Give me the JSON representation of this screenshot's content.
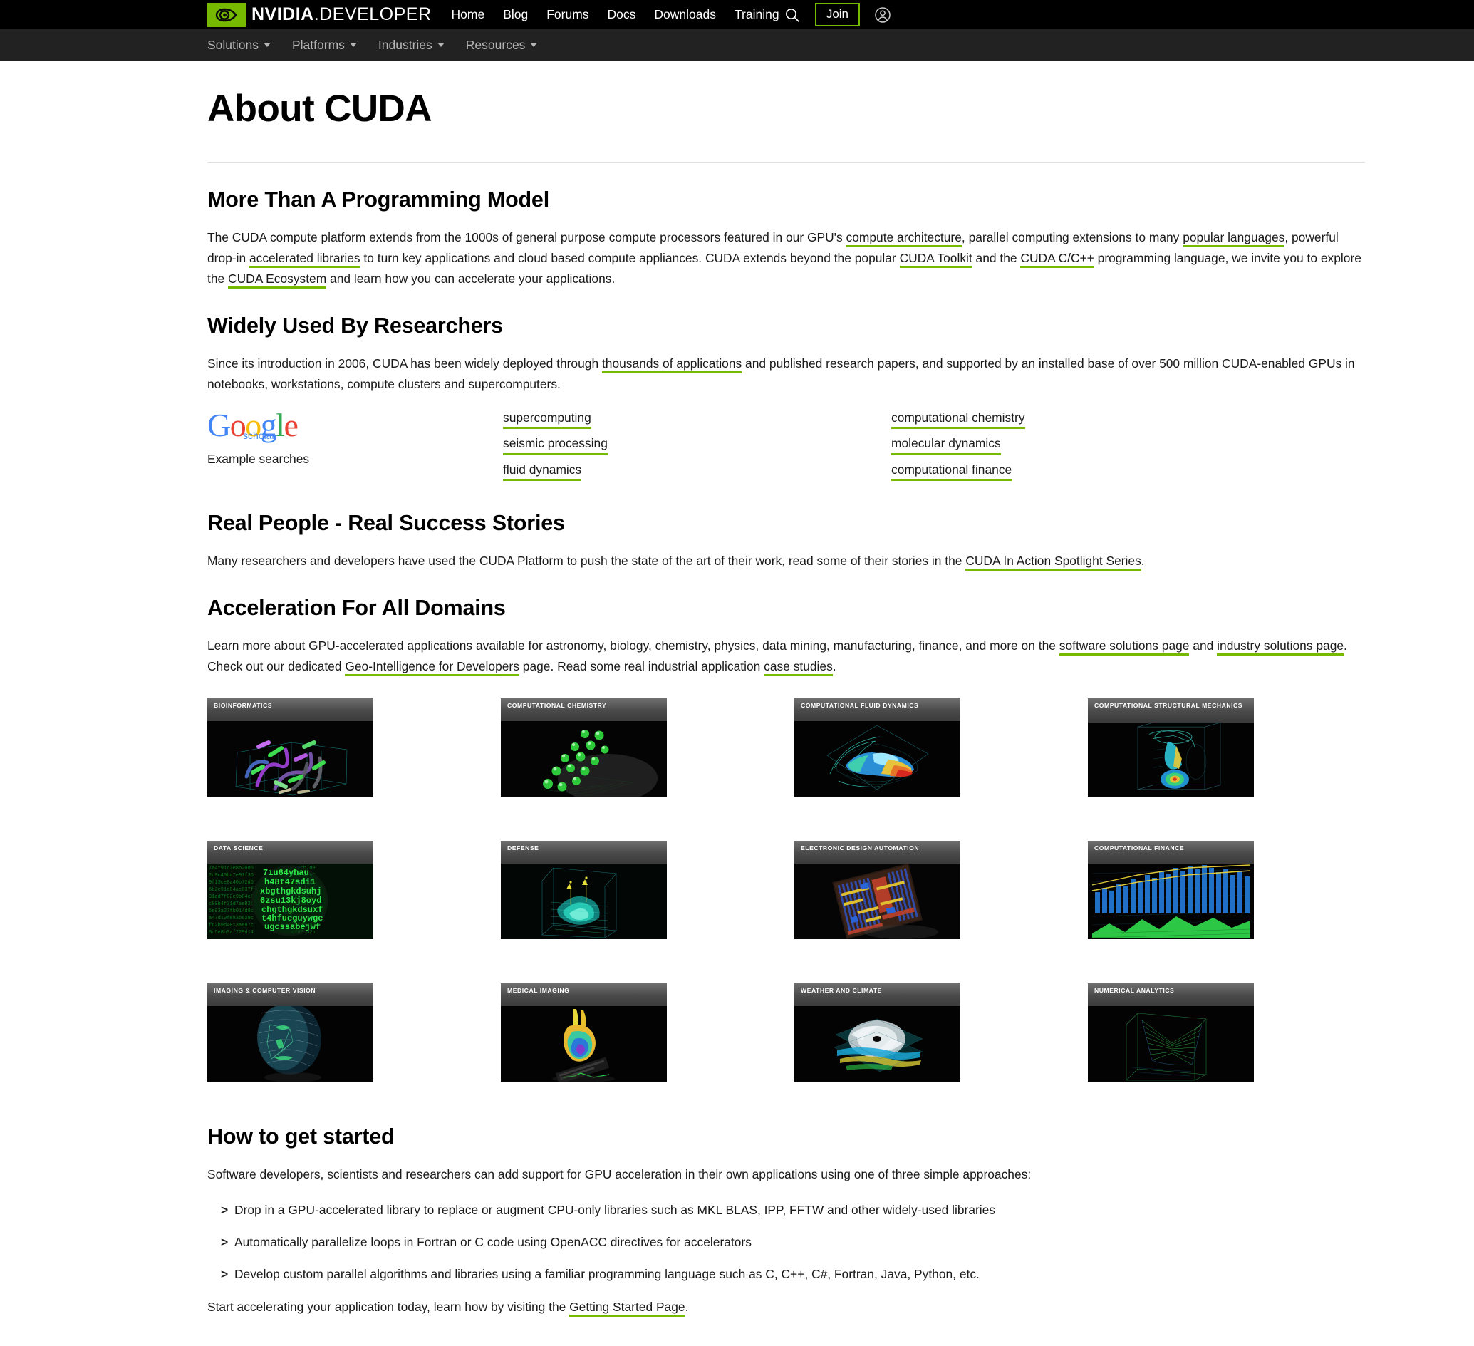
{
  "header": {
    "brand_bold": "NVIDIA",
    "brand_light": ".DEVELOPER",
    "nav": [
      {
        "label": "Home"
      },
      {
        "label": "Blog"
      },
      {
        "label": "Forums"
      },
      {
        "label": "Docs"
      },
      {
        "label": "Downloads"
      },
      {
        "label": "Training"
      }
    ],
    "search_icon": "search-icon",
    "join_label": "Join",
    "account_icon": "account-icon",
    "accent_green": "#76b900",
    "bar_background": "#000000"
  },
  "subnav": {
    "background": "#222222",
    "items": [
      {
        "label": "Solutions"
      },
      {
        "label": "Platforms"
      },
      {
        "label": "Industries"
      },
      {
        "label": "Resources"
      }
    ]
  },
  "page": {
    "title": "About CUDA"
  },
  "sections": {
    "programming_model": {
      "heading": "More Than A Programming Model",
      "paragraph": {
        "p1": "The CUDA compute platform extends from the 1000s of general purpose compute processors featured in our GPU's ",
        "link1": "compute architecture",
        "p2": ", parallel computing extensions to many ",
        "link2": "popular languages",
        "p3": ", powerful drop-in ",
        "link3": "accelerated libraries",
        "p4": " to turn key applications and cloud based compute appliances. CUDA extends beyond the popular ",
        "link4": "CUDA Toolkit",
        "p5": " and the ",
        "link5": "CUDA C/C++",
        "p6": " programming language, we invite you to explore the ",
        "link6": "CUDA Ecosystem",
        "p7": " and learn how you can accelerate your applications."
      }
    },
    "researchers": {
      "heading": "Widely Used By Researchers",
      "paragraph": {
        "p1": "Since its introduction in 2006, CUDA has been widely deployed through ",
        "link1": "thousands of applications",
        "p2": " and published research papers, and supported by an installed base of over 500 million CUDA-enabled GPUs in notebooks, workstations, compute clusters and supercomputers."
      },
      "scholar": {
        "logo_letters": [
          "G",
          "o",
          "o",
          "g",
          "l",
          "e"
        ],
        "logo_subtext": "scholar",
        "example_label": "Example searches",
        "searches_col1": [
          "supercomputing",
          "seismic processing",
          "fluid dynamics"
        ],
        "searches_col2": [
          "computational chemistry",
          "molecular dynamics",
          "computational finance"
        ]
      }
    },
    "success_stories": {
      "heading": "Real People - Real Success Stories",
      "paragraph": {
        "p1": "Many researchers and developers have used the CUDA Platform to push the state of the art of their work, read some of their stories in the ",
        "link1": "CUDA In Action Spotlight Series",
        "p2": "."
      }
    },
    "acceleration": {
      "heading": "Acceleration For All Domains",
      "paragraph": {
        "p1": "Learn more about GPU-accelerated applications available for astronomy, biology, chemistry, physics, data mining, manufacturing, finance, and more on the ",
        "link1": "software solutions page",
        "p2": " and ",
        "link2": "industry solutions page",
        "p3": ". Check out our dedicated ",
        "link3": "Geo-Intelligence for Developers",
        "p4": " page. Read some real industrial application ",
        "link4": "case studies",
        "p5": "."
      },
      "tiles": [
        {
          "caption": "BIOINFORMATICS",
          "art": "protein"
        },
        {
          "caption": "COMPUTATIONAL CHEMISTRY",
          "art": "molecules"
        },
        {
          "caption": "COMPUTATIONAL FLUID DYNAMICS",
          "art": "car"
        },
        {
          "caption": "COMPUTATIONAL STRUCTURAL MECHANICS",
          "art": "engine"
        },
        {
          "caption": "DATA SCIENCE",
          "art": "matrix"
        },
        {
          "caption": "DEFENSE",
          "art": "terrain"
        },
        {
          "caption": "ELECTRONIC DESIGN AUTOMATION",
          "art": "chip"
        },
        {
          "caption": "COMPUTATIONAL FINANCE",
          "art": "bars"
        },
        {
          "caption": "IMAGING & COMPUTER VISION",
          "art": "face"
        },
        {
          "caption": "MEDICAL IMAGING",
          "art": "heart"
        },
        {
          "caption": "WEATHER AND CLIMATE",
          "art": "hurricane"
        },
        {
          "caption": "NUMERICAL ANALYTICS",
          "art": "mesh"
        }
      ]
    },
    "get_started": {
      "heading": "How to get started",
      "intro": "Software developers, scientists and researchers can add support for GPU acceleration in their own applications using one of  three simple approaches:",
      "bullets": [
        "Drop in a GPU-accelerated library to replace or augment CPU-only libraries such as MKL BLAS, IPP, FFTW and other widely-used libraries",
        "Automatically parallelize loops in Fortran or C code using OpenACC directives for accelerators",
        "Develop custom parallel algorithms and libraries using a familiar programming language such as C, C++, C#, Fortran, Java, Python, etc."
      ],
      "closing": {
        "p1": "Start accelerating your application today, learn how by visiting the ",
        "link1": "Getting Started Page",
        "p2": "."
      }
    }
  }
}
